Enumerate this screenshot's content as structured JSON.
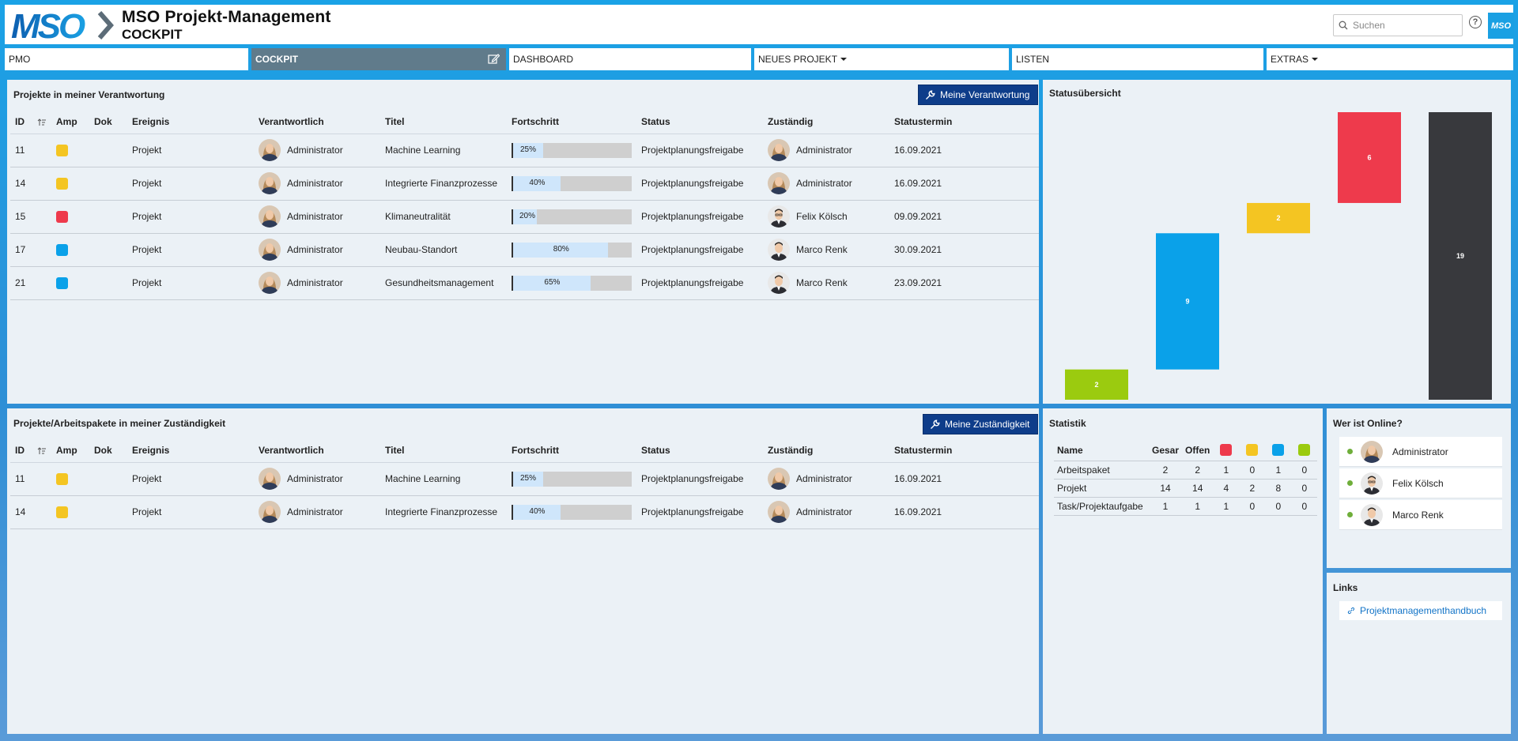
{
  "app": {
    "title": "MSO Projekt-Management",
    "subtitle": "COCKPIT",
    "logo_text": "MSO",
    "mini_logo_text": "MSO"
  },
  "search": {
    "placeholder": "Suchen",
    "value": ""
  },
  "nav": {
    "tabs": [
      {
        "label": "PMO",
        "active": false,
        "dropdown": false
      },
      {
        "label": "COCKPIT",
        "active": true,
        "dropdown": false
      },
      {
        "label": "DASHBOARD",
        "active": false,
        "dropdown": false
      },
      {
        "label": "NEUES PROJEKT",
        "active": false,
        "dropdown": true
      },
      {
        "label": "LISTEN",
        "active": false,
        "dropdown": false
      },
      {
        "label": "EXTRAS",
        "active": false,
        "dropdown": true
      }
    ]
  },
  "colors": {
    "red": "#ee3a4c",
    "yellow": "#f4c522",
    "blue": "#0aa1e9",
    "green": "#9bcb0f",
    "dark": "#38393d",
    "button": "#0e3d8a"
  },
  "verantwortung": {
    "title": "Projekte in meiner Verantwortung",
    "button": "Meine Verantwortung",
    "columns": [
      "ID",
      "Amp",
      "Dok",
      "Ereignis",
      "Verantwortlich",
      "Titel",
      "Fortschritt",
      "Status",
      "Zuständig",
      "Statustermin"
    ],
    "rows": [
      {
        "id": "11",
        "ampel": "yellow",
        "ereignis": "Projekt",
        "verantwortlich": "Administrator",
        "titel": "Machine Learning",
        "progress": 25,
        "progress_label": "25%",
        "status": "Projektplanungsfreigabe",
        "zustaendig": "Administrator",
        "termin": "16.09.2021"
      },
      {
        "id": "14",
        "ampel": "yellow",
        "ereignis": "Projekt",
        "verantwortlich": "Administrator",
        "titel": "Integrierte Finanzprozesse",
        "progress": 40,
        "progress_label": "40%",
        "status": "Projektplanungsfreigabe",
        "zustaendig": "Administrator",
        "termin": "16.09.2021"
      },
      {
        "id": "15",
        "ampel": "red",
        "ereignis": "Projekt",
        "verantwortlich": "Administrator",
        "titel": "Klimaneutralität",
        "progress": 20,
        "progress_label": "20%",
        "status": "Projektplanungsfreigabe",
        "zustaendig": "Felix Kölsch",
        "termin": "09.09.2021"
      },
      {
        "id": "17",
        "ampel": "blue",
        "ereignis": "Projekt",
        "verantwortlich": "Administrator",
        "titel": "Neubau-Standort",
        "progress": 80,
        "progress_label": "80%",
        "status": "Projektplanungsfreigabe",
        "zustaendig": "Marco Renk",
        "termin": "30.09.2021"
      },
      {
        "id": "21",
        "ampel": "blue",
        "ereignis": "Projekt",
        "verantwortlich": "Administrator",
        "titel": "Gesundheitsmanagement",
        "progress": 65,
        "progress_label": "65%",
        "status": "Projektplanungsfreigabe",
        "zustaendig": "Marco Renk",
        "termin": "23.09.2021"
      }
    ]
  },
  "zustaendigkeit": {
    "title": "Projekte/Arbeitspakete in meiner Zuständigkeit",
    "button": "Meine Zuständigkeit",
    "columns": [
      "ID",
      "Amp",
      "Dok",
      "Ereignis",
      "Verantwortlich",
      "Titel",
      "Fortschritt",
      "Status",
      "Zuständig",
      "Statustermin"
    ],
    "rows": [
      {
        "id": "11",
        "ampel": "yellow",
        "ereignis": "Projekt",
        "verantwortlich": "Administrator",
        "titel": "Machine Learning",
        "progress": 25,
        "progress_label": "25%",
        "status": "Projektplanungsfreigabe",
        "zustaendig": "Administrator",
        "termin": "16.09.2021"
      },
      {
        "id": "14",
        "ampel": "yellow",
        "ereignis": "Projekt",
        "verantwortlich": "Administrator",
        "titel": "Integrierte Finanzprozesse",
        "progress": 40,
        "progress_label": "40%",
        "status": "Projektplanungsfreigabe",
        "zustaendig": "Administrator",
        "termin": "16.09.2021"
      }
    ]
  },
  "statusuebersicht": {
    "title": "Statusübersicht"
  },
  "chart_data": {
    "type": "bar",
    "subtype": "waterfall",
    "title": "",
    "categories": [
      "green",
      "blue",
      "yellow",
      "red",
      "total"
    ],
    "values": [
      2,
      9,
      2,
      6,
      19
    ],
    "labels": [
      "2",
      "9",
      "2",
      "6",
      "19"
    ],
    "colors": [
      "#9bcb0f",
      "#0aa1e9",
      "#f4c522",
      "#ee3a4c",
      "#38393d"
    ],
    "ylim": [
      0,
      19
    ],
    "grid": false
  },
  "statistik": {
    "title": "Statistik",
    "columns": [
      "Name",
      "Gesar",
      "Offen"
    ],
    "color_columns": [
      "red",
      "yellow",
      "blue",
      "green"
    ],
    "rows": [
      {
        "name": "Arbeitspaket",
        "values": [
          "2",
          "2",
          "1",
          "0",
          "1",
          "0"
        ]
      },
      {
        "name": "Projekt",
        "values": [
          "14",
          "14",
          "4",
          "2",
          "8",
          "0"
        ]
      },
      {
        "name": "Task/Projektaufgabe",
        "values": [
          "1",
          "1",
          "1",
          "0",
          "0",
          "0"
        ]
      }
    ]
  },
  "online": {
    "title": "Wer ist Online?",
    "users": [
      "Administrator",
      "Felix Kölsch",
      "Marco Renk"
    ]
  },
  "links": {
    "title": "Links",
    "items": [
      "Projektmanagementhandbuch"
    ]
  }
}
